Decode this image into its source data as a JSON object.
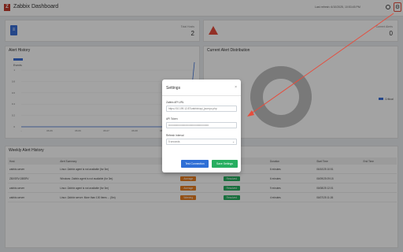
{
  "header": {
    "logo_glyph": "Z",
    "title": "Zabbix Dashboard",
    "last_refresh": "Last refresh: 6/10/2025, 10:53:45 PM",
    "gear_glyph": "⚙"
  },
  "stats": {
    "hosts_icon": "server-icon",
    "hosts_label": "Total Hosts",
    "hosts_value": "2",
    "alerts_icon": "warning-icon",
    "alerts_label": "Current Alerts",
    "alerts_value": "0"
  },
  "alert_history": {
    "title": "Alert History",
    "series_label": "Events",
    "ticks_y": [
      "1",
      "0.8",
      "0.6",
      "0.4",
      "0.2",
      "0"
    ],
    "ticks_x": [
      "...",
      "06.06",
      "06.06",
      "06.07",
      "06.08",
      "06.09",
      "06.10"
    ]
  },
  "distribution": {
    "title": "Current Alert Distribution",
    "legend": "Critical"
  },
  "weekly": {
    "title": "Weekly Alert History",
    "columns": [
      "Host",
      "Alert Summary",
      "Severity",
      "Status",
      "Duration",
      "Start Time",
      "End Time"
    ],
    "rows": [
      {
        "host": "zabbix-server",
        "summary": "Linux: Zabbix agent is not available (for 3m)",
        "severity": "Average",
        "status": "Resolved",
        "duration": "6 minutes",
        "start": "06/10/25 10:51",
        "end": ""
      },
      {
        "host": "ZBXSRV-DBSRV",
        "summary": "Windows: Zabbix agent is not available (for 3m)",
        "severity": "Average",
        "status": "Resolved",
        "duration": "6 minutes",
        "start": "06/09/25 09:18",
        "end": ""
      },
      {
        "host": "zabbix-server",
        "summary": "Linux: Zabbix agent is not available (for 3m)",
        "severity": "Average",
        "status": "Resolved",
        "duration": "9 minutes",
        "start": "06/08/25 12:01",
        "end": ""
      },
      {
        "host": "zabbix-server",
        "summary": "Linux: Zabbix server: More than 100 items ... (5m)",
        "severity": "Warning",
        "status": "Resolved",
        "duration": "4 minutes",
        "start": "06/07/25 11:26",
        "end": ""
      }
    ]
  },
  "settings_modal": {
    "title": "Settings",
    "close_glyph": "×",
    "api_url_label": "Zabbix API URL",
    "api_url_value": "https://10.199.12.87/zabbix/api_jsonrpc.php",
    "token_label": "API Token",
    "token_value": "••••••••••••••••••••••••••••••••••••••••••••••",
    "refresh_label": "Refresh Interval",
    "refresh_value": "5 seconds",
    "test_button": "Test Connection",
    "save_button": "Save Settings"
  },
  "colors": {
    "accent": "#2e6fd6",
    "success": "#27ae60",
    "danger": "#e74c3c",
    "warning": "#e67e22"
  }
}
